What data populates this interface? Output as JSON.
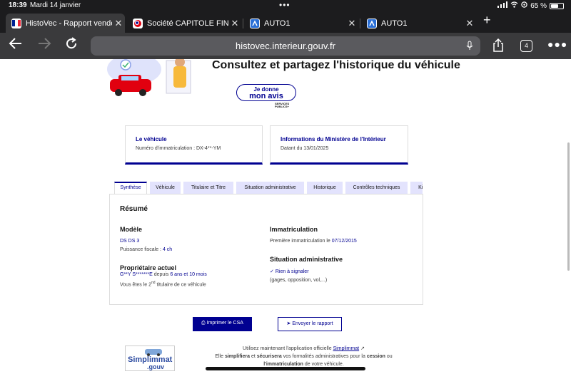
{
  "status_bar": {
    "time": "18:39",
    "date": "Mardi 14 janvier",
    "battery": "65 %",
    "battery_level": 0.65
  },
  "tabs": [
    {
      "title": "HistoVec - Rapport vendeur",
      "close": "✕",
      "active": true
    },
    {
      "title": "Société CAPITOLE FINANCE",
      "close": "✕",
      "active": false
    },
    {
      "title": "AUTO1",
      "close": "✕",
      "active": false
    },
    {
      "title": "AUTO1",
      "close": "✕",
      "active": false
    }
  ],
  "toolbar": {
    "url": "histovec.interieur.gouv.fr",
    "tab_count": "4"
  },
  "hero": {
    "title": "Consultez et partagez l'historique du véhicule",
    "avis_line1": "Je donne",
    "avis_line2": "mon avis",
    "sp_line1": "SERVICES",
    "sp_line2": "PUBLICS+"
  },
  "cards": {
    "vehicle": {
      "title": "Le véhicule",
      "value": "Numéro d'immatriculation : DX-4**-YM"
    },
    "ministry": {
      "title": "Informations du Ministère de l'Intérieur",
      "value": "Datant du 13/01/2025"
    }
  },
  "page_tabs": [
    "Synthèse",
    "Véhicule",
    "Titulaire et Titre",
    "Situation administrative",
    "Historique",
    "Contrôles techniques",
    "Kil"
  ],
  "summary": {
    "heading": "Résumé",
    "model": {
      "label": "Modèle",
      "value": "DS DS 3",
      "power_label": "Puissance fiscale :",
      "power_value": "4 ch"
    },
    "registration": {
      "label": "Immatriculation",
      "first_label": "Première immatriculation le",
      "first_value": "07/12/2015"
    },
    "owner": {
      "label": "Propriétaire actuel",
      "name": "G**Y S*******E",
      "since_label": "depuis",
      "since_value": "6 ans et 10 mois",
      "rank_prefix": "Vous êtes le",
      "rank_num": "2",
      "rank_sup": "nd",
      "rank_suffix": "titulaire de ce véhicule"
    },
    "admin": {
      "label": "Situation administrative",
      "status": "Rien à signaler",
      "detail": "(gages, opposition, vol,...)"
    }
  },
  "actions": {
    "print": "Imprimer le CSA",
    "send": "Envoyer le rapport"
  },
  "footer": {
    "logo_line1": "Simplimmat",
    "logo_line2": ".gouv",
    "line1_prefix": "Utilisez maintenant l'application officielle",
    "line1_link": "Simplimmat",
    "line2_a": "Elle",
    "line2_b": "simplifiera",
    "line2_c": "et",
    "line2_d": "sécurisera",
    "line2_e": "vos formalités administratives pour la",
    "line2_f": "cession",
    "line2_g": "ou",
    "line3_a": "l'immatriculation",
    "line3_b": "de votre véhicule."
  },
  "colors": {
    "dsfr_blue": "#000091",
    "tab_bg": "#e3e3fd"
  }
}
